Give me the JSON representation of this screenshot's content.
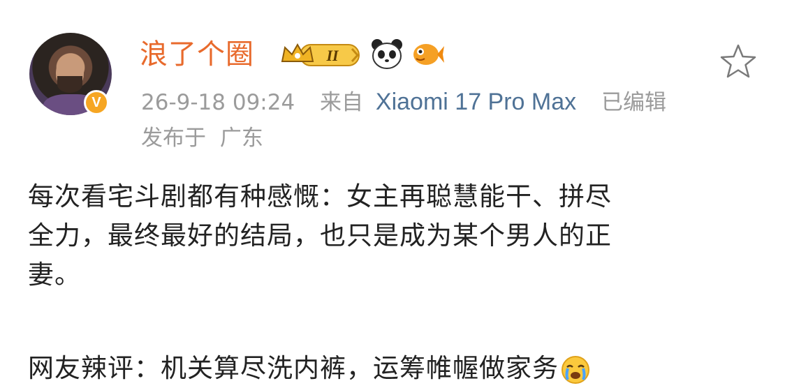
{
  "post": {
    "username": "浪了个圈",
    "level_badge": "II",
    "timestamp": "26-9-18 09:24",
    "source_prefix": "来自",
    "device": "Xiaomi 17 Pro Max",
    "edited_label": "已编辑",
    "location_prefix": "发布于",
    "location": "广东",
    "body_lines": [
      "每次看宅斗剧都有种感慨：女主再聪慧能干、拼尽",
      "全力，最终最好的结局，也只是成为某个男人的正",
      "妻。"
    ],
    "comment": "网友辣评：机关算尽洗内裤，运筹帷幄做家务",
    "icons": {
      "verified": "verified-v-icon",
      "crown": "crown-level-icon",
      "panda": "panda-icon",
      "fish": "goldfish-icon",
      "star": "star-outline-icon",
      "emoji": "crying-emoji-icon"
    },
    "colors": {
      "username": "#e86a2c",
      "meta": "#9b9b9b",
      "device": "#4f7296",
      "verified": "#f6a623",
      "text": "#222222"
    }
  }
}
